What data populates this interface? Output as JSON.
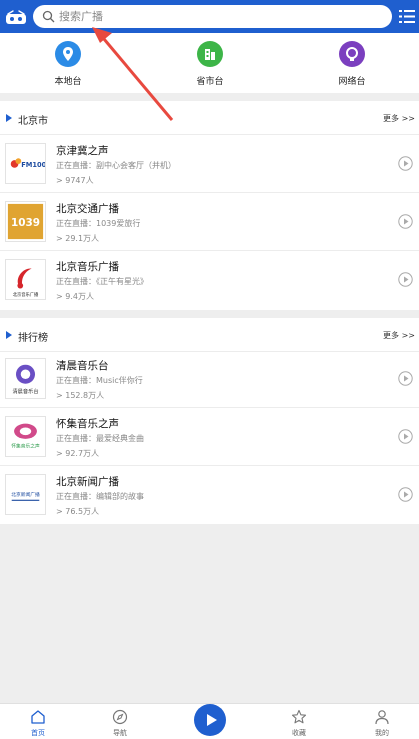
{
  "header": {
    "search": {
      "placeholder": "搜索广播",
      "value": ""
    }
  },
  "categories": [
    {
      "label": "本地台",
      "icon": "location-pin-icon",
      "color": "#2b8be6"
    },
    {
      "label": "省市台",
      "icon": "building-icon",
      "color": "#3db548"
    },
    {
      "label": "网络台",
      "icon": "globe-icon",
      "color": "#7b3fbf"
    }
  ],
  "sections": [
    {
      "title": "北京市",
      "more": "更多 >>",
      "items": [
        {
          "name": "京津冀之声",
          "live": "正在直播：副中心会客厅（并机）",
          "count": "> 9747人"
        },
        {
          "name": "北京交通广播",
          "live": "正在直播：1039爱旅行",
          "count": "> 29.1万人"
        },
        {
          "name": "北京音乐广播",
          "live": "正在直播：《正午有星光》",
          "count": "> 9.4万人"
        }
      ]
    },
    {
      "title": "排行榜",
      "more": "更多 >>",
      "items": [
        {
          "name": "清晨音乐台",
          "live": "正在直播：Music伴你行",
          "count": "> 152.8万人"
        },
        {
          "name": "怀集音乐之声",
          "live": "正在直播：最爱经典金曲",
          "count": "> 92.7万人"
        },
        {
          "name": "北京新闻广播",
          "live": "正在直播：编辑部的故事",
          "count": "> 76.5万人"
        }
      ]
    }
  ],
  "logos": [
    {
      "text": "FM1006",
      "icon": "jingjinji-logo-icon"
    },
    {
      "text": "1039",
      "icon": "traffic-radio-logo-icon"
    },
    {
      "text": "北京音乐广播",
      "icon": "music-radio-logo-icon"
    },
    {
      "text": "清晨音乐台",
      "icon": "morning-music-logo-icon"
    },
    {
      "text": "怀集音乐之声",
      "icon": "huaiji-music-logo-icon"
    },
    {
      "text": "北京新闻广播",
      "icon": "news-radio-logo-icon"
    }
  ],
  "bottom_nav": [
    {
      "label": "首页",
      "icon": "home-icon",
      "active": true
    },
    {
      "label": "导航",
      "icon": "compass-icon",
      "active": false
    },
    {
      "label": "",
      "icon": "play-icon",
      "active": false
    },
    {
      "label": "收藏",
      "icon": "star-icon",
      "active": false
    },
    {
      "label": "我的",
      "icon": "user-icon",
      "active": false
    }
  ],
  "colors": {
    "brand": "#1f5fcf",
    "annotation_arrow": "#e8493f"
  }
}
